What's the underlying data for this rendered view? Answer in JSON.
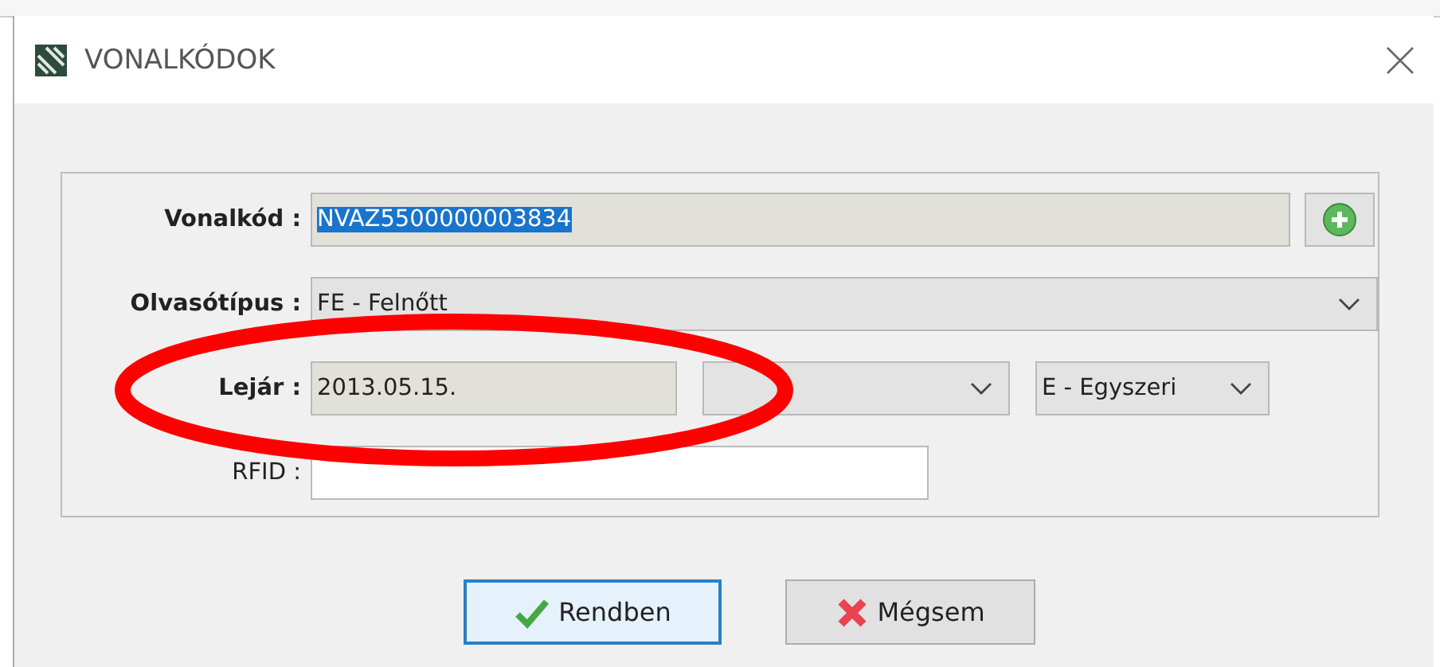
{
  "window": {
    "title": "VONALKÓDOK"
  },
  "form": {
    "rows": [
      {
        "label": "Vonalkód :",
        "bold": true,
        "kind": "text",
        "value": "NVAZ5500000003834",
        "value_selected": true,
        "add_button": true
      },
      {
        "label": "Olvasótípus :",
        "bold": true,
        "kind": "combo",
        "value": "FE - Felnőtt"
      },
      {
        "label": "Lejár :",
        "bold": true,
        "kind": "text",
        "value": "2013.05.15.",
        "extras": [
          {
            "kind": "combo"
          },
          {
            "kind": "combo",
            "value": "E - Egyszeri"
          }
        ]
      },
      {
        "label": "RFID :",
        "bold": false,
        "kind": "input"
      }
    ]
  },
  "buttons": [
    {
      "label": "Rendben",
      "kind": "confirm",
      "default": true
    },
    {
      "label": "Mégsem",
      "kind": "cancel",
      "default": false
    }
  ],
  "annotation": {
    "kind": "ellipse"
  }
}
